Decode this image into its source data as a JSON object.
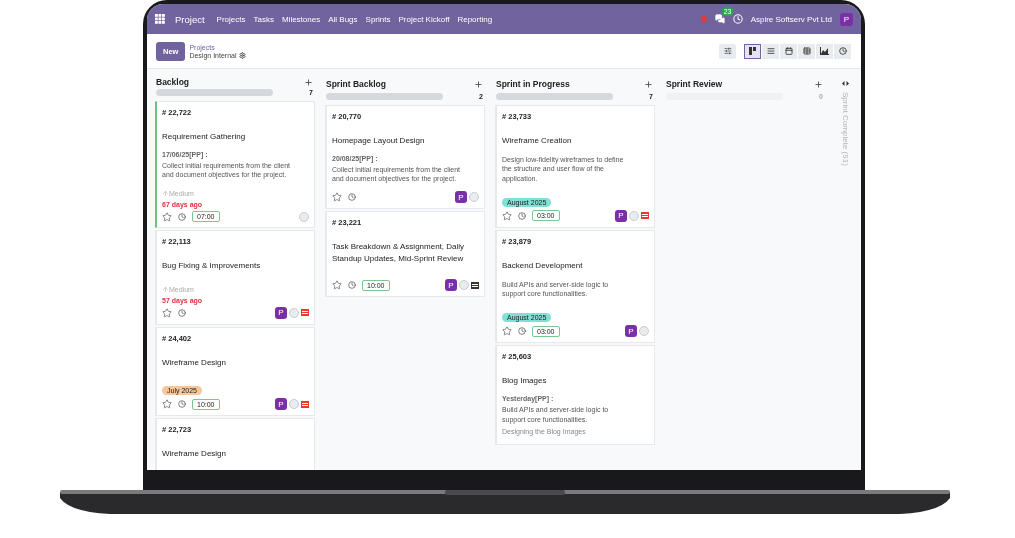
{
  "navbar": {
    "brand": "Project",
    "menu": [
      "Projects",
      "Tasks",
      "Milestones",
      "All Bugs",
      "Sprints",
      "Project Kickoff",
      "Reporting"
    ],
    "messages_badge": "23",
    "company": "Aspire Softserv Pvt Ltd",
    "avatar": "P"
  },
  "control_panel": {
    "new_button": "New",
    "breadcrumb": "Projects",
    "record": "Design Internal",
    "views": [
      {
        "kind": "kanban",
        "selected": true
      },
      {
        "kind": "list",
        "selected": false
      },
      {
        "kind": "calendar",
        "selected": false
      },
      {
        "kind": "pivot",
        "selected": false
      },
      {
        "kind": "graph",
        "selected": false
      },
      {
        "kind": "activity",
        "selected": false
      }
    ]
  },
  "columns": [
    {
      "name": "Backlog",
      "count": "7",
      "empty": false,
      "cards": [
        {
          "number": "# 22,722",
          "title": "Requirement Gathering",
          "highlighted": true,
          "note_date": "17/06/25[PP] :",
          "description": "Collect initial requirements from the client and document objectives for the project.",
          "priority": "Medium",
          "age": "67 days ago",
          "time": "07:00"
        },
        {
          "number": "# 22,113",
          "title": "Bug Fixing & Improvements",
          "highlighted": false,
          "priority": "Medium",
          "age": "57 days ago",
          "avatar": "P",
          "attachment": {
            "color": "#e8392c"
          }
        },
        {
          "number": "# 24,402",
          "title": "Wireframe Design",
          "highlighted": false,
          "tag": {
            "label": "July 2025",
            "color": "#f7c79a"
          },
          "time": "10:00",
          "avatar": "P",
          "attachment": {
            "color": "#e8392c"
          }
        },
        {
          "number": "# 22,723",
          "title": "Wireframe Design",
          "highlighted": false
        }
      ]
    },
    {
      "name": "Sprint Backlog",
      "count": "2",
      "empty": false,
      "cards": [
        {
          "number": "# 20,770",
          "title": "Homepage Layout Design",
          "highlighted": false,
          "note_date": "20/08/25[PP] :",
          "description": "Collect initial requirements from the client and document objectives for the project.",
          "avatar": "P"
        },
        {
          "number": "# 23,221",
          "title": "Task Breakdown & Assignment, Daily Standup Updates, Mid-Sprint Review",
          "highlighted": false,
          "time": "10:00",
          "avatar": "P",
          "attachment": {
            "color": "#3a3230"
          }
        }
      ]
    },
    {
      "name": "Sprint in Progress",
      "count": "7",
      "empty": false,
      "cards": [
        {
          "number": "# 23,733",
          "title": "Wireframe Creation",
          "highlighted": false,
          "description": "Design low-fidelity wireframes to define the structure and user flow of the application.",
          "tag": {
            "label": "August 2025",
            "color": "#7fe0d6"
          },
          "time": "03:00",
          "avatar": "P",
          "attachment": {
            "color": "#e8392c"
          }
        },
        {
          "number": "# 23,879",
          "title": "Backend Development",
          "highlighted": false,
          "description": "Build APIs and server-side logic to support core functionalities.",
          "tag": {
            "label": "August 2025",
            "color": "#7fe0d6"
          },
          "time": "03:00",
          "avatar": "P"
        },
        {
          "number": "# 25,603",
          "title": "Blog Images",
          "highlighted": false,
          "description": "Build APIs and server-side logic to support core functionalities.",
          "note_date": "Yesterday[PP] :",
          "note_text": "Designing the Blog Images"
        }
      ]
    },
    {
      "name": "Sprint Review",
      "count": "0",
      "empty": true
    }
  ],
  "folded_column": "Sprint Complete (91)"
}
